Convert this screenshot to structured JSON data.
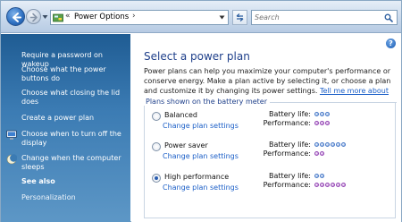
{
  "address_bar": {
    "separator": "«",
    "location": "Power Options",
    "chevron": "›"
  },
  "search": {
    "placeholder": "Search"
  },
  "sidebar": {
    "links": [
      {
        "label": "Require a password on wakeup"
      },
      {
        "label": "Choose what the power buttons do"
      },
      {
        "label": "Choose what closing the lid does"
      },
      {
        "label": "Create a power plan"
      },
      {
        "label": "Choose when to turn off the display",
        "icon": "monitor-icon"
      },
      {
        "label": "Change when the computer sleeps",
        "icon": "moon-icon"
      }
    ],
    "see_also": "See also",
    "see_also_links": [
      {
        "label": "Personalization"
      }
    ]
  },
  "main": {
    "help": "?",
    "title": "Select a power plan",
    "intro": "Power plans can help you maximize your computer's performance or conserve energy. Make a plan active by selecting it, or choose a plan and customize it by changing its power settings.",
    "intro_link": "Tell me more about power plans",
    "group_label": "Plans shown on the battery meter",
    "battery_label": "Battery life:",
    "performance_label": "Performance:",
    "change_link": "Change plan settings",
    "plans": [
      {
        "name": "Balanced",
        "selected": false,
        "battery_life": 3,
        "performance": 3
      },
      {
        "name": "Power saver",
        "selected": false,
        "battery_life": 6,
        "performance": 2
      },
      {
        "name": "High performance",
        "selected": true,
        "battery_life": 2,
        "performance": 6
      }
    ]
  },
  "colors": {
    "sidebar_top": "#1f5c93",
    "title_blue": "#1e3f8a",
    "link_blue": "#1a5ec7",
    "battery_dot": "#6f9be0",
    "performance_dot": "#b66fd1"
  }
}
